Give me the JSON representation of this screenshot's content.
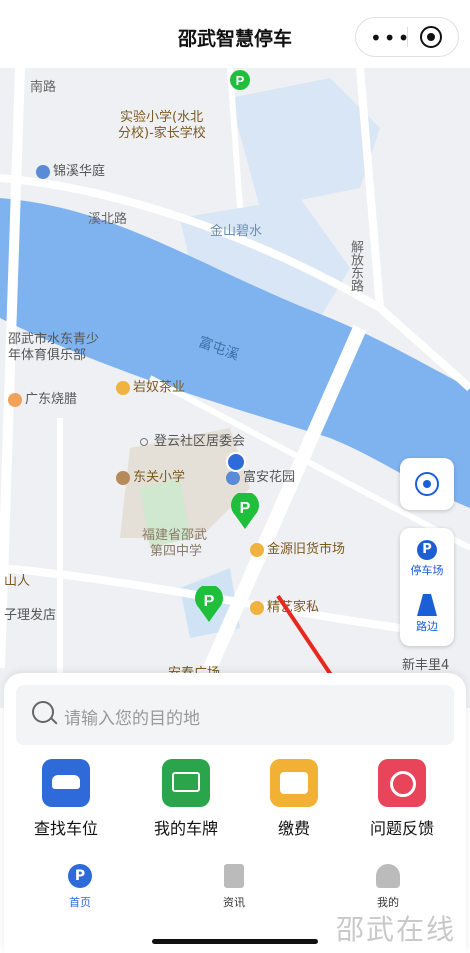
{
  "header": {
    "title": "邵武智慧停车"
  },
  "map": {
    "labels": {
      "nan_lu": "南路",
      "school": "实验小学(水北",
      "school2": "分校)-家长学校",
      "jinxi": "锦溪华庭",
      "xibei": "溪北路",
      "jinshan": "金山碧水",
      "jiefang": "解放东路",
      "sports": "邵武市水东青少",
      "sports2": "年体育俱乐部",
      "futunxi": "富屯溪",
      "guangdong": "广东烧腊",
      "yannu": "岩奴茶业",
      "dengyun": "登云社区居委会",
      "dongguan": "东关小学",
      "fuan": "富安花园",
      "middle": "福建省邵武",
      "middle2": "第四中学",
      "jinyuan": "金源旧货市场",
      "shanren": "山人",
      "barber": "子理发店",
      "jingyi": "精艺家私",
      "anchun": "安春广场",
      "xinfeng": "新丰里4"
    },
    "side": {
      "parking_lot": "停车场",
      "roadside": "路边"
    }
  },
  "panel": {
    "search_placeholder": "请输入您的目的地",
    "functions": [
      {
        "label": "查找车位",
        "color": "#2f6ad9"
      },
      {
        "label": "我的车牌",
        "color": "#2aa54c"
      },
      {
        "label": "缴费",
        "color": "#f2b134"
      },
      {
        "label": "问题反馈",
        "color": "#e8455a"
      }
    ]
  },
  "tabs": [
    {
      "label": "首页",
      "active": true
    },
    {
      "label": "资讯",
      "active": false
    },
    {
      "label": "我的",
      "active": false
    }
  ],
  "watermark": "邵武在线"
}
